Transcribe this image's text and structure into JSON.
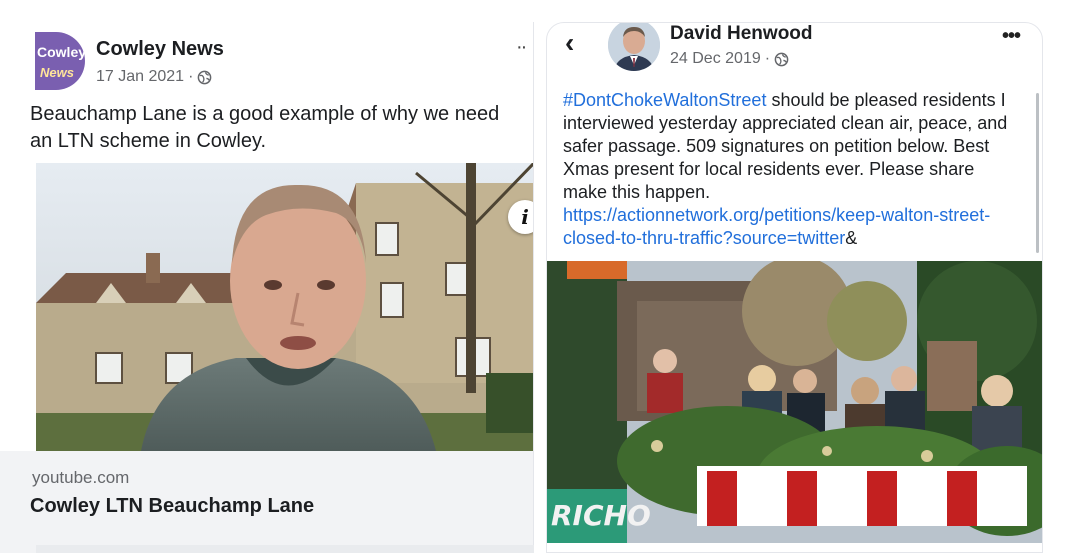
{
  "left_post": {
    "page_name": "Cowley News",
    "avatar_text_line1": "Cowley",
    "avatar_text_line2": "News",
    "date": "17 Jan 2021",
    "separator": "·",
    "more_label": "··",
    "text_line1": "Beauchamp Lane is a good example of why we need",
    "text_line2": "an LTN scheme in Cowley.",
    "info_label": "i",
    "link_domain": "youtube.com",
    "link_title": "Cowley LTN Beauchamp Lane"
  },
  "right_post": {
    "back_label": "‹",
    "user_name": "David Henwood",
    "date": "24 Dec 2019",
    "separator": "·",
    "more_label": "•••",
    "hashtag": "#DontChokeWaltonStreet",
    "body_text": " should be pleased residents I interviewed yesterday appreciated clean air, peace, and safer passage. 509 signatures on petition below. Best Xmas present for local residents ever. Please share make this happen.",
    "url": "https://actionnetwork.org/petitions/keep-walton-street-closed-to-thru-traffic?source=twitter",
    "url_suffix": "&",
    "banner_text": "RICHO"
  },
  "icons": {
    "globe": "globe-icon",
    "info": "info-icon",
    "back": "chevron-left-icon",
    "more": "more-horizontal-icon"
  },
  "colors": {
    "link": "#216fdb",
    "meta": "#65676b",
    "text": "#1c1e21"
  }
}
